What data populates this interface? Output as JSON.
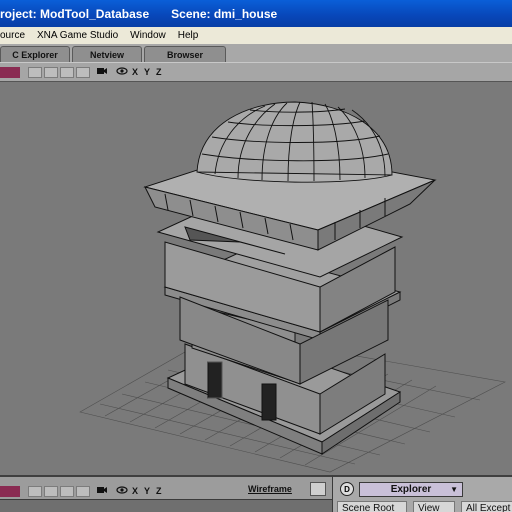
{
  "window": {
    "title_project": "roject: ModTool_Database",
    "title_scene": "Scene:  dmi_house"
  },
  "menubar": {
    "items": [
      "ource",
      "XNA Game Studio",
      "Window",
      "Help"
    ]
  },
  "tabs": [
    {
      "label": "C Explorer"
    },
    {
      "label": "Netview"
    },
    {
      "label": "Browser"
    }
  ],
  "viewport_toolbar": {
    "icons": [
      "camera-icon",
      "eye-icon"
    ],
    "axes": [
      "X",
      "Y",
      "Z"
    ]
  },
  "bottom_left": {
    "axes": [
      "X",
      "Y",
      "Z"
    ],
    "display_mode": "Wireframe"
  },
  "bottom_right": {
    "badge": "D",
    "explorer_label": "Explorer",
    "buttons": [
      "Scene Root",
      "View",
      "All Except"
    ]
  },
  "colors": {
    "titlebar": "#0846b8",
    "menubar": "#ece9d8",
    "viewport": "#7a7a7a",
    "explorer_select": "#c9c0d8"
  }
}
